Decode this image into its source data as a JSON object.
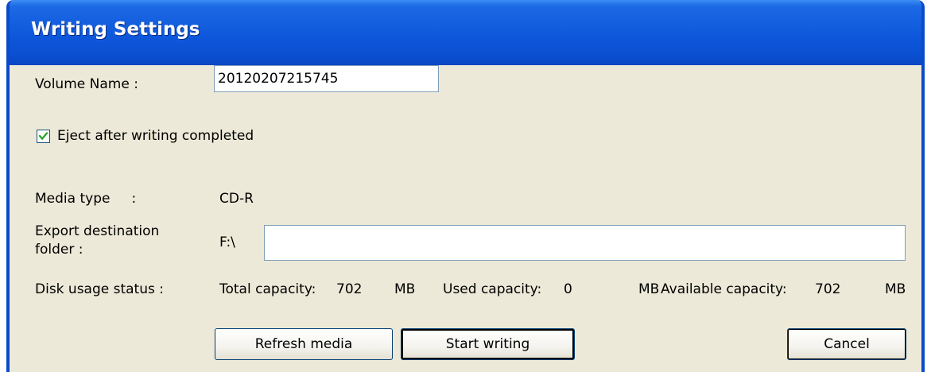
{
  "window": {
    "title": "Writing Settings"
  },
  "volume": {
    "label": "Volume Name :",
    "value": "20120207215745"
  },
  "eject": {
    "label": "Eject after writing completed",
    "checked": true
  },
  "media": {
    "label": "Media type     :",
    "value": "CD-R"
  },
  "destination": {
    "label_line1": "Export destination",
    "label_line2": "folder :",
    "drive": "F:\\",
    "value": ""
  },
  "disk_usage": {
    "label": "Disk usage status :",
    "total_label": "Total capacity:",
    "total_value": "702",
    "total_unit": "MB",
    "used_label": "Used capacity:",
    "used_value": "0",
    "used_unit": "MB",
    "available_label": "Available capacity:",
    "available_value": "702",
    "available_unit": "MB"
  },
  "buttons": {
    "refresh": "Refresh media",
    "start": "Start writing",
    "cancel": "Cancel"
  },
  "colors": {
    "title_bar": "#0a4fd0",
    "dialog_bg": "#ece9d8",
    "button_border": "#003c74"
  }
}
